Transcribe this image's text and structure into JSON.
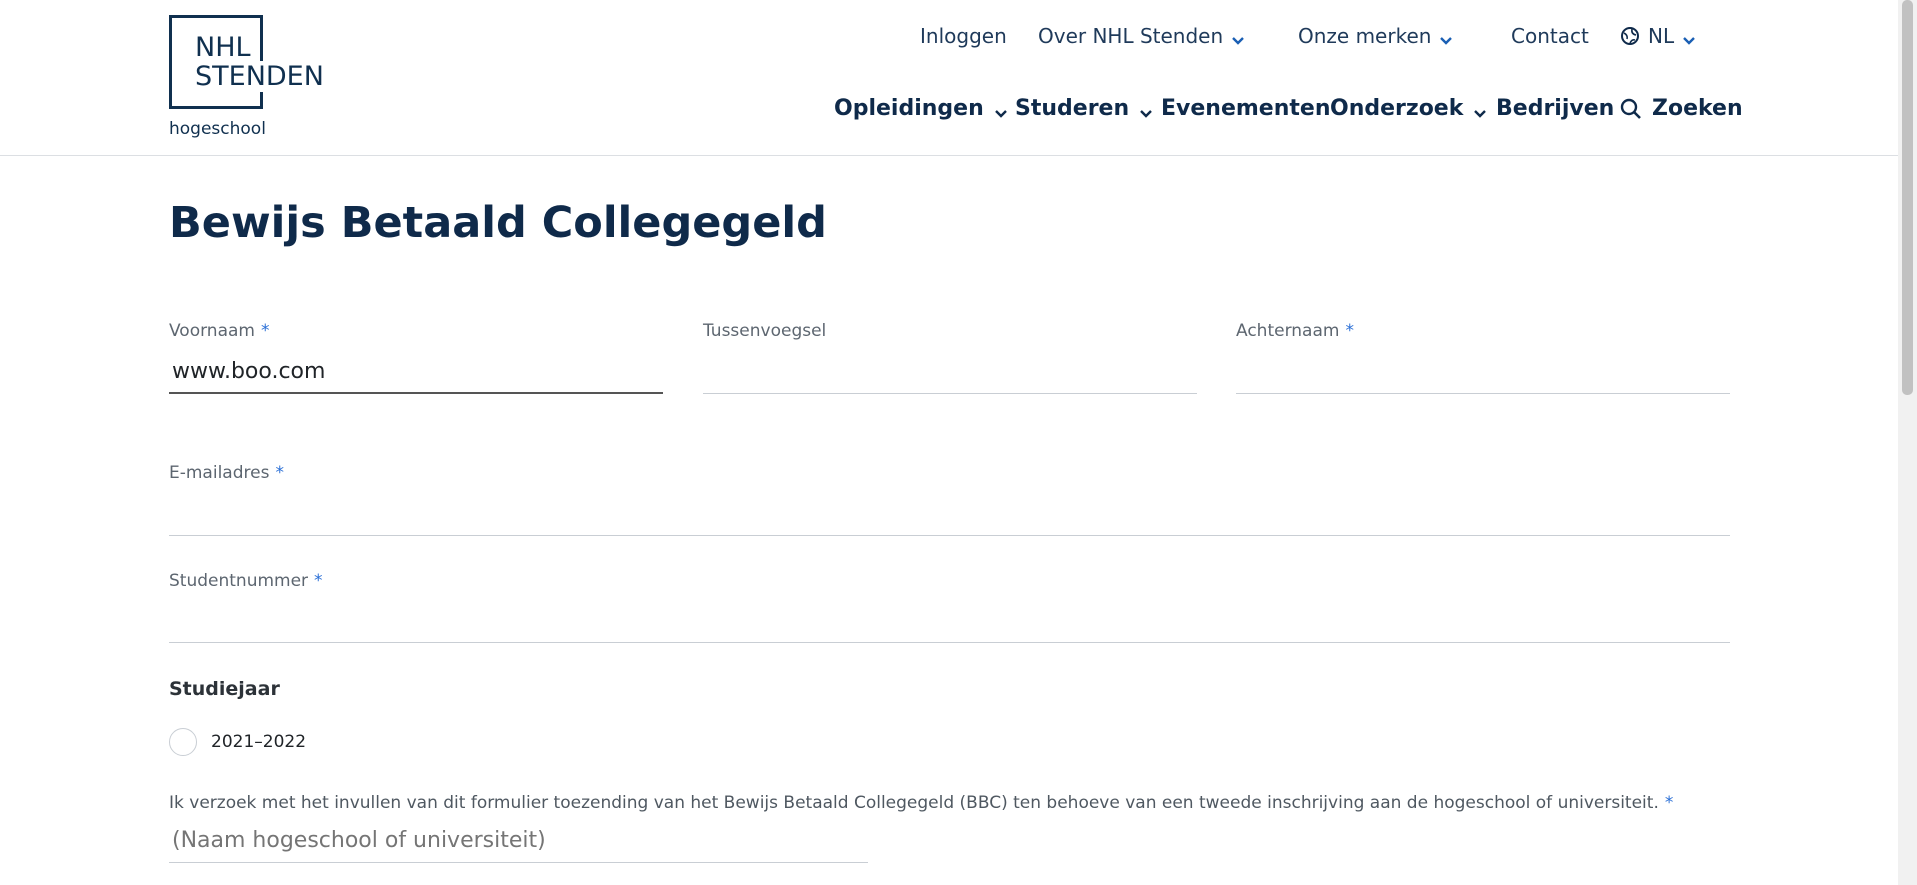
{
  "logo": {
    "line1": "NHL",
    "line2": "STENDEN",
    "subtitle": "hogeschool"
  },
  "topnav": {
    "inloggen": "Inloggen",
    "over": "Over NHL Stenden",
    "merken": "Onze merken",
    "contact": "Contact",
    "lang": "NL"
  },
  "mainnav": {
    "opleidingen": "Opleidingen",
    "studeren": "Studeren",
    "evenementen": "Evenementen",
    "onderzoek": "Onderzoek",
    "bedrijven": "Bedrijven",
    "zoeken": "Zoeken"
  },
  "page": {
    "title": "Bewijs Betaald Collegegeld"
  },
  "form": {
    "voornaam": {
      "label": "Voornaam",
      "required": "*",
      "value": "www.boo.com"
    },
    "tussenvoegsel": {
      "label": "Tussenvoegsel",
      "value": ""
    },
    "achternaam": {
      "label": "Achternaam",
      "required": "*",
      "value": ""
    },
    "email": {
      "label": "E-mailadres",
      "required": "*",
      "value": ""
    },
    "studentnummer": {
      "label": "Studentnummer",
      "required": "*",
      "value": ""
    },
    "studiejaar": {
      "heading": "Studiejaar",
      "option": "2021–2022"
    },
    "consent": {
      "text": "Ik verzoek met het invullen van dit formulier toezending van het Bewijs Betaald Collegegeld (BBC) ten behoeve van een tweede inschrijving aan de hogeschool of universiteit.",
      "required": "*",
      "placeholder": "(Naam hogeschool of universiteit)"
    }
  },
  "colors": {
    "brand": "#0f2a4a",
    "required": "#2a6fd6"
  }
}
